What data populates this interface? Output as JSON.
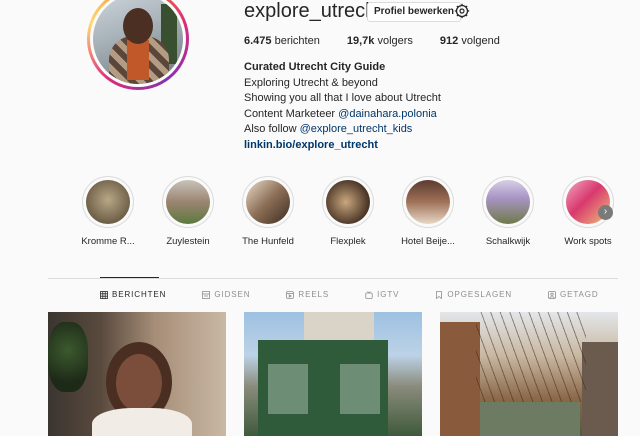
{
  "profile": {
    "username": "explore_utrecht",
    "edit_label": "Profiel bewerken",
    "stats": {
      "posts": "6.475",
      "posts_label": "berichten",
      "followers": "19,7k",
      "followers_label": "volgers",
      "following": "912",
      "following_label": "volgend"
    },
    "bio": {
      "name": "Curated Utrecht City Guide",
      "line1": "Exploring Utrecht & beyond",
      "line2": "Showing you all that I love about Utrecht",
      "line3_prefix": "Content Marketeer ",
      "line3_mention": "@dainahara.polonia",
      "line4_prefix": "Also follow ",
      "line4_mention": "@explore_utrecht_kids",
      "link": "linkin.bio/explore_utrecht"
    }
  },
  "highlights": [
    {
      "label": "Kromme R...",
      "color": "#8a7d66"
    },
    {
      "label": "Zuylestein",
      "color": "#7e8a6a"
    },
    {
      "label": "The Hunfeld",
      "color": "#6a5a4a"
    },
    {
      "label": "Flexplek",
      "color": "#5a4a3a"
    },
    {
      "label": "Hotel Beije...",
      "color": "#7a5a4c"
    },
    {
      "label": "Schalkwijk",
      "color": "#8b7fa8"
    },
    {
      "label": "Work spots",
      "color": "#c2406e"
    }
  ],
  "highlights_next_icon": "chevron-right",
  "tabs": [
    {
      "label": "BERICHTEN",
      "icon": "grid-icon",
      "active": true
    },
    {
      "label": "GIDSEN",
      "icon": "guide-icon",
      "active": false
    },
    {
      "label": "REELS",
      "icon": "reels-icon",
      "active": false
    },
    {
      "label": "IGTV",
      "icon": "igtv-icon",
      "active": false
    },
    {
      "label": "OPGESLAGEN",
      "icon": "bookmark-icon",
      "active": false
    },
    {
      "label": "GETAGD",
      "icon": "tag-icon",
      "active": false
    }
  ],
  "colors": {
    "link": "#00376b",
    "text": "#262626",
    "muted": "#8e8e8e",
    "border": "#dbdbdb"
  }
}
